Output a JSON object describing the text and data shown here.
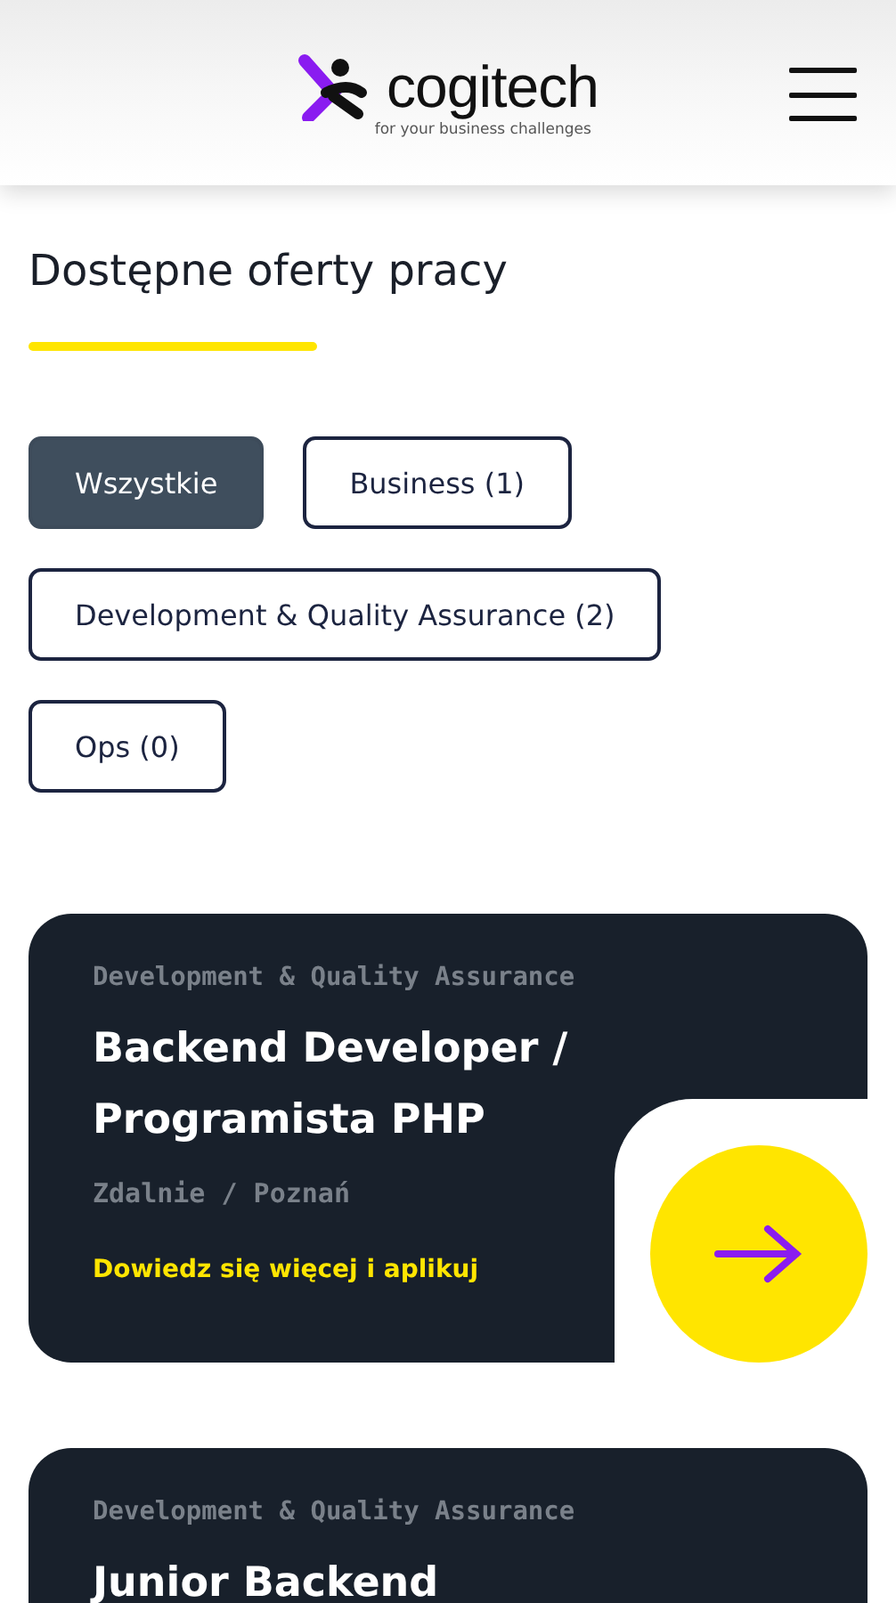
{
  "header": {
    "logo_text": "cogitech",
    "tagline": "for your business challenges"
  },
  "section": {
    "title": "Dostępne oferty pracy"
  },
  "filters": [
    {
      "label": "Wszystkie",
      "selected": true
    },
    {
      "label": "Business (1)",
      "selected": false
    },
    {
      "label": "Development & Quality Assurance (2)",
      "selected": false
    },
    {
      "label": "Ops (0)",
      "selected": false
    }
  ],
  "jobs": [
    {
      "category": "Development & Quality Assurance",
      "title": "Backend Developer / Programista PHP",
      "location": "Zdalnie / Poznań",
      "link": "Dowiedz się więcej i aplikuj"
    },
    {
      "category": "Development & Quality Assurance",
      "title": "Junior Backend"
    }
  ]
}
